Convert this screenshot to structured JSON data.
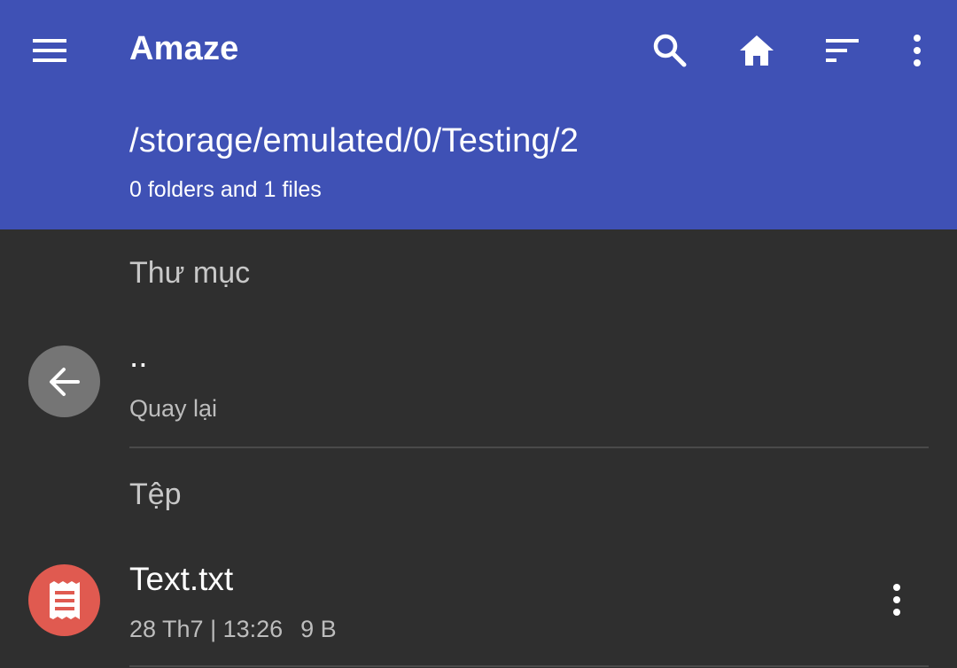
{
  "appbar": {
    "title": "Amaze",
    "path": "/storage/emulated/0/Testing/2",
    "summary": "0 folders and 1 files",
    "color": "#3f51b5",
    "icons": {
      "menu": "menu-icon",
      "search": "search-icon",
      "home": "home-icon",
      "sort": "sort-icon",
      "overflow": "more-vert-icon"
    }
  },
  "sections": {
    "folders_header": "Thư mục",
    "files_header": "Tệp"
  },
  "back_row": {
    "title": "..",
    "subtitle": "Quay lại",
    "icon": "arrow-back-icon",
    "avatar_color": "#757575"
  },
  "files": [
    {
      "name": "Text.txt",
      "date": "28 Th7 | 13:26",
      "size": "9 B",
      "icon": "text-file-icon",
      "avatar_color": "#e05a50"
    }
  ]
}
